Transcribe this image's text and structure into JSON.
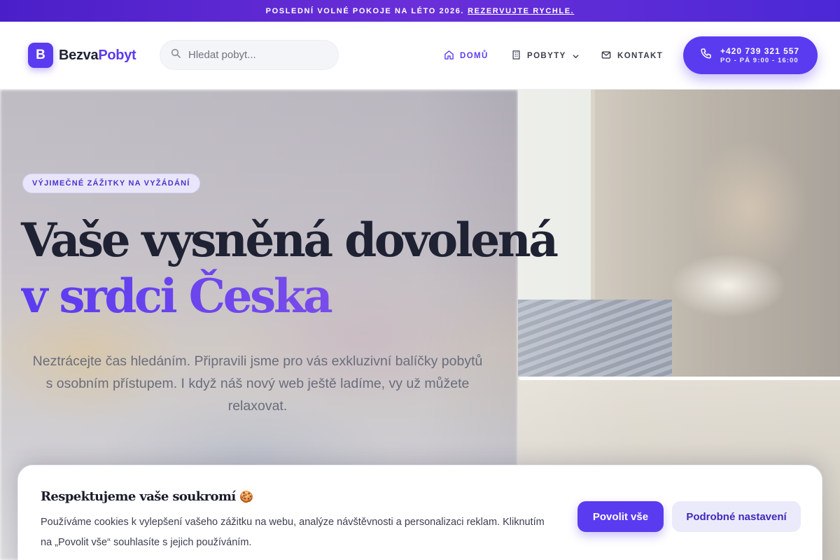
{
  "announcement": {
    "text": "POSLEDNÍ VOLNÉ POKOJE NA LÉTO 2026.",
    "link": "REZERVUJTE RYCHLE."
  },
  "header": {
    "logo_letter": "B",
    "brand_part1": "Bezva",
    "brand_part2": "Pobyt",
    "search_placeholder": "Hledat pobyt...",
    "nav": [
      {
        "label": "DOMŮ",
        "icon": "home-icon",
        "active": true
      },
      {
        "label": "POBYTY",
        "icon": "building-icon",
        "dropdown": true
      },
      {
        "label": "KONTAKT",
        "icon": "mail-icon"
      }
    ],
    "phone": "+420 739 321 557",
    "hours": "PO - PÁ 9:00 - 16:00"
  },
  "hero": {
    "badge": "VÝJIMEČNÉ ZÁŽITKY NA VYŽÁDÁNÍ",
    "title_line1": "Vaše vysněná dovolená",
    "title_line2": "v srdci Česka",
    "subtitle": "Neztrácejte čas hledáním. Připravili jsme pro vás exkluzivní balíčky pobytů s osobním přístupem. I když náš nový web ještě ladíme, vy už můžete relaxovat."
  },
  "cookie": {
    "title": "Respektujeme vaše soukromí",
    "title_glyph": "🍪",
    "text": "Používáme cookies k vylepšení vašeho zážitku na webu, analýze návštěvnosti a personalizaci reklam. Kliknutím na „Povolit vše“ souhlasíte s jejich používáním.",
    "accept_label": "Povolit vše",
    "settings_label": "Podrobné nastavení"
  },
  "colors": {
    "accent": "#5b3bf0",
    "topbar_gradient_start": "#4a1fc9",
    "topbar_gradient_end": "#4b28d6"
  }
}
